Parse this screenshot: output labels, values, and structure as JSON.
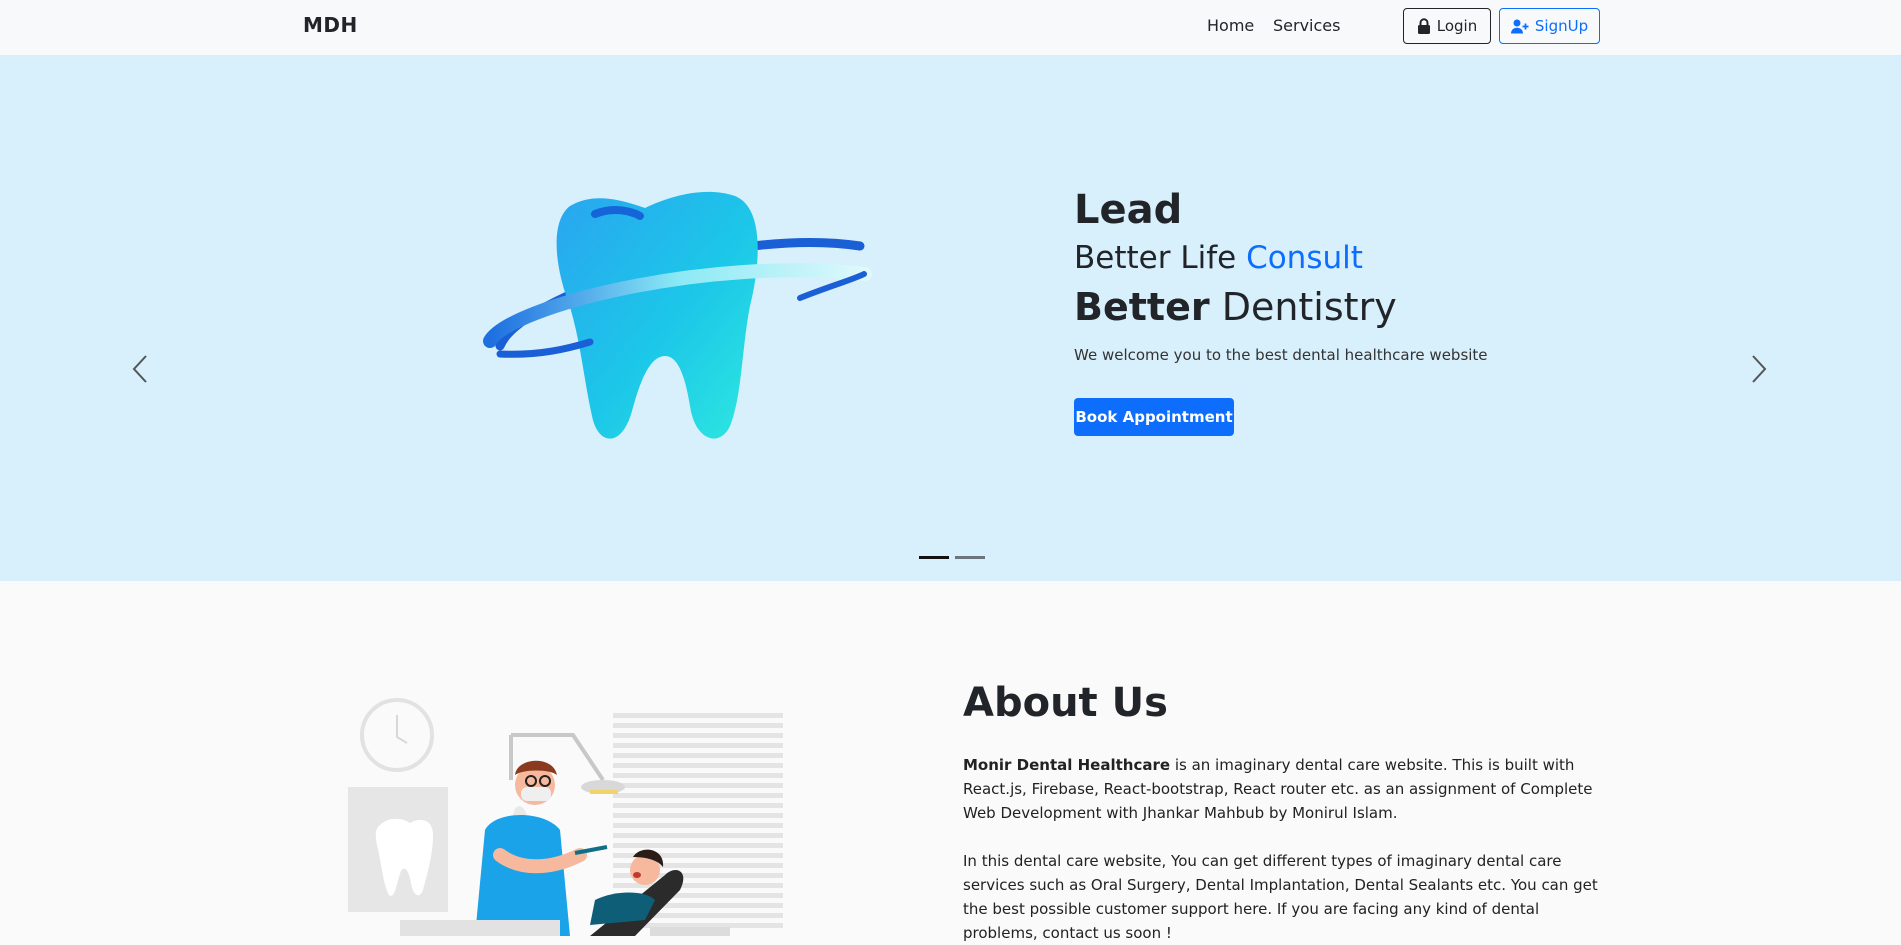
{
  "navbar": {
    "brand": "MDH",
    "links": [
      {
        "label": "Home"
      },
      {
        "label": "Services"
      }
    ],
    "login_label": "Login",
    "signup_label": "SignUp"
  },
  "hero": {
    "title": "Lead",
    "line2_prefix": "Better Life",
    "line2_accent": "Consult",
    "line3_bold": "Better",
    "line3_rest": "Dentistry",
    "subtitle": "We welcome you to the best dental healthcare website",
    "cta_label": "Book Appointment",
    "active_slide": 1,
    "slide_count": 2
  },
  "about": {
    "title": "About Us",
    "p1_bold": "Monir Dental Healthcare",
    "p1_rest": " is an imaginary dental care website. This is built with React.js, Firebase, React-bootstrap, React router etc. as an assignment of Complete Web Development with Jhankar Mahbub by Monirul Islam.",
    "p2": "In this dental care website, You can get different types of imaginary dental care services such as Oral Surgery, Dental Implantation, Dental Sealants etc. You can get the best possible customer support here. If you are facing any kind of dental problems, contact us soon !"
  },
  "colors": {
    "primary": "#0d6efd",
    "hero_bg": "#d8effc",
    "navbar_bg": "#f8f9fa"
  }
}
